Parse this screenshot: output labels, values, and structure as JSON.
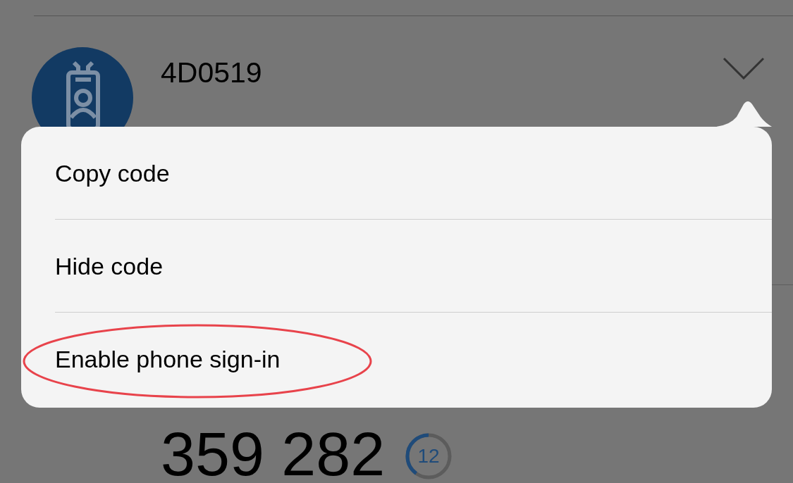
{
  "account": {
    "name": "4D0519",
    "code": "359 282",
    "countdown": {
      "seconds": "12",
      "level": 0.4
    }
  },
  "menu": {
    "items": [
      {
        "label": "Copy code",
        "highlighted": false
      },
      {
        "label": "Hide code",
        "highlighted": false
      },
      {
        "label": "Enable phone sign-in",
        "highlighted": true
      }
    ]
  }
}
